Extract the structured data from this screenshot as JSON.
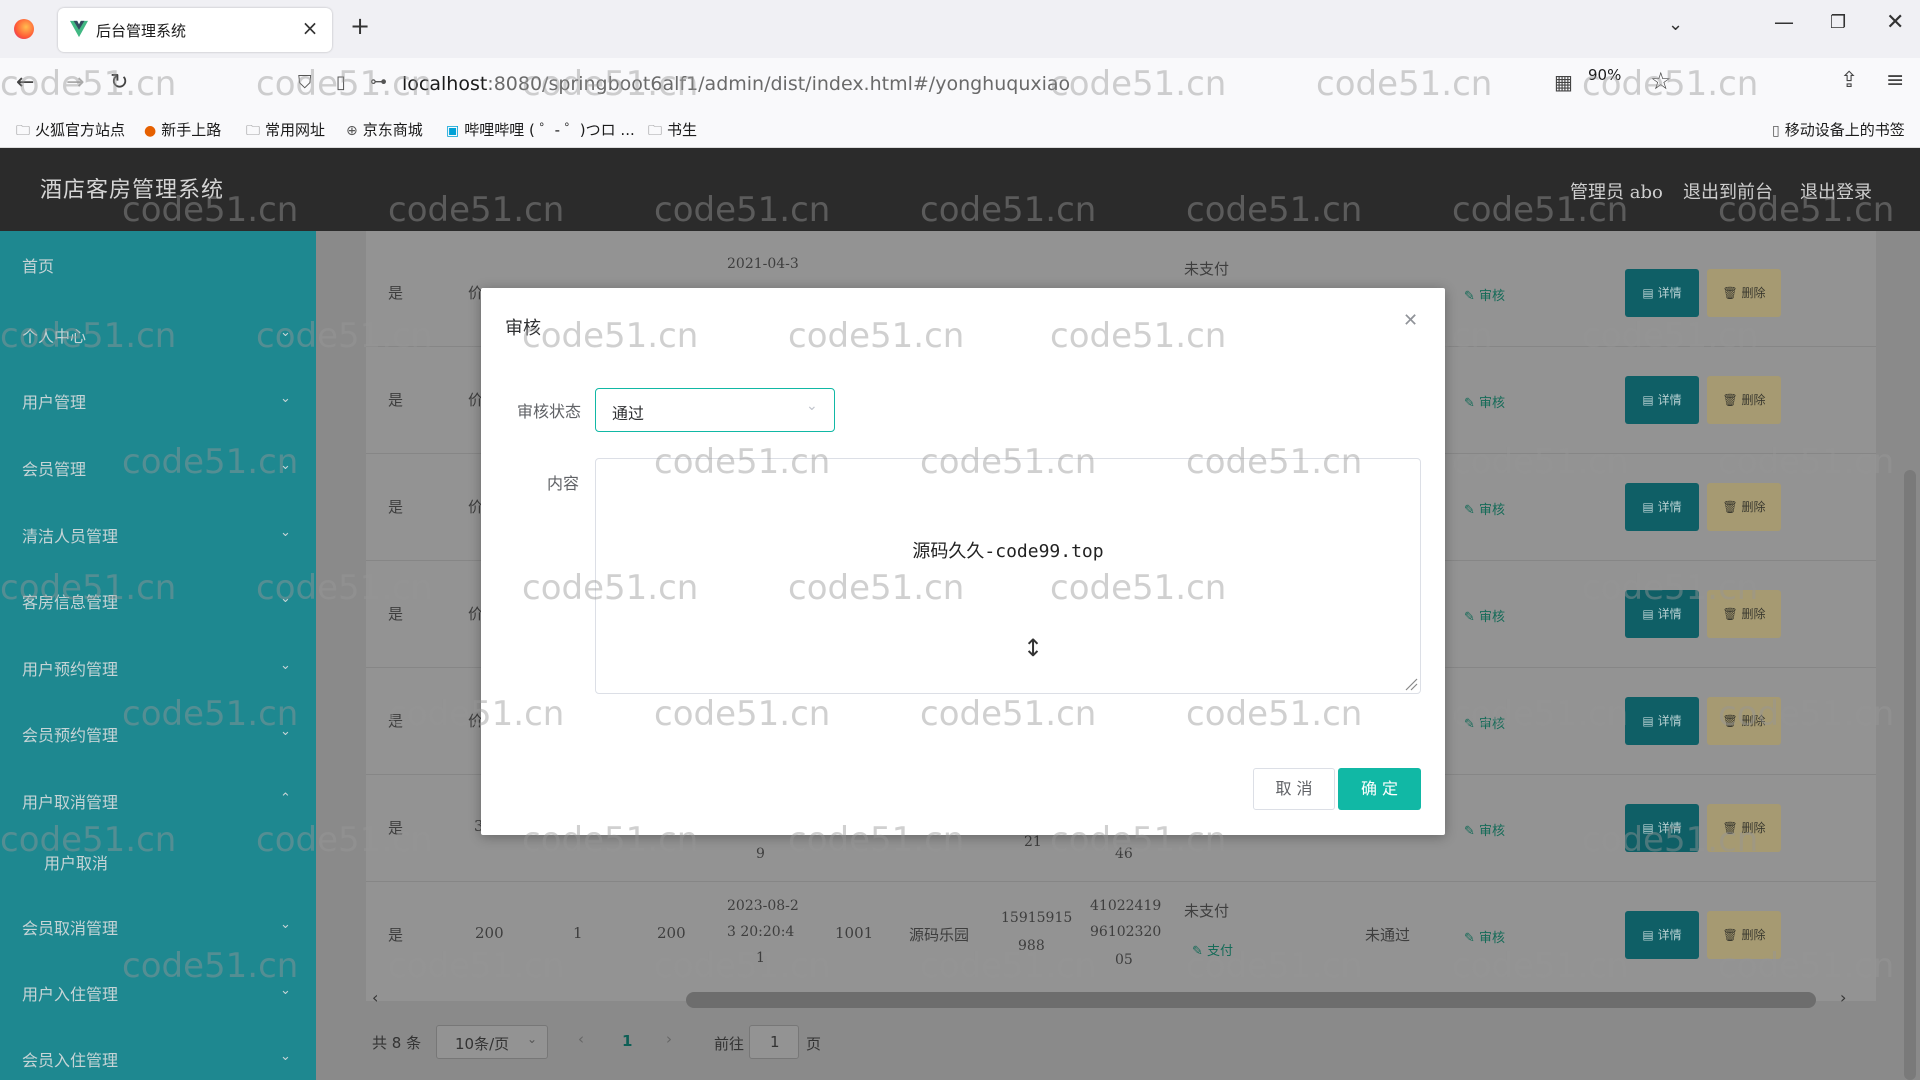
{
  "browser": {
    "tab_title": "后台管理系统",
    "url_host": "localhost",
    "url_rest": ":8080/springboot6alf1/admin/dist/index.html#/yonghuquxiao",
    "zoom": "90%",
    "bookmarks": [
      "火狐官方站点",
      "新手上路",
      "常用网址",
      "京东商城",
      "哔哩哔哩 ( ゜- ゜)つロ ...",
      "书生"
    ],
    "mobile_bookmarks": "移动设备上的书签"
  },
  "header": {
    "title": "酒店客房管理系统",
    "admin": "管理员 abo",
    "to_front": "退出到前台",
    "logout": "退出登录"
  },
  "sidebar": {
    "items": [
      {
        "label": "首页"
      },
      {
        "label": "个人中心"
      },
      {
        "label": "用户管理"
      },
      {
        "label": "会员管理"
      },
      {
        "label": "清洁人员管理"
      },
      {
        "label": "客房信息管理"
      },
      {
        "label": "用户预约管理"
      },
      {
        "label": "会员预约管理"
      },
      {
        "label": "用户取消管理"
      },
      {
        "label": "用户取消"
      },
      {
        "label": "会员取消管理"
      },
      {
        "label": "用户入住管理"
      },
      {
        "label": "会员入住管理"
      }
    ]
  },
  "table": {
    "rows": [
      {
        "c1": "是",
        "c2": "价",
        "date": "2021-04-3",
        "pay": "未支付"
      },
      {
        "c1": "是",
        "c2": "价"
      },
      {
        "c1": "是",
        "c2": "价"
      },
      {
        "c1": "是",
        "c2": "价"
      },
      {
        "c1": "是",
        "c2": "价"
      },
      {
        "c1": "是",
        "c2": "3",
        "frag1": "9",
        "frag2": "21",
        "frag3": "46"
      },
      {
        "c1": "是",
        "c2": "200",
        "c3": "1",
        "c4": "200",
        "date_l1": "2023-08-2",
        "date_l2": "3 20:20:4",
        "date_l3": "1",
        "room": "1001",
        "name": "源码乐园",
        "phone_l1": "15915915",
        "phone_l2": "988",
        "id_l1": "41022419",
        "id_l2": "96102320",
        "id_l3": "05",
        "pay": "未支付",
        "pay_link": "支付",
        "review": "未通过"
      }
    ],
    "audit_link": "审核",
    "detail_btn": "详情",
    "delete_btn": "删除"
  },
  "pagination": {
    "total": "共 8 条",
    "page_size": "10条/页",
    "current_page": "1",
    "goto_prefix": "前往",
    "goto_value": "1",
    "goto_suffix": "页"
  },
  "modal": {
    "title": "审核",
    "status_label": "审核状态",
    "status_value": "通过",
    "content_label": "内容",
    "content_value": "源码久久-code99.top",
    "cancel": "取 消",
    "confirm": "确 定"
  },
  "watermark": "code51.cn"
}
